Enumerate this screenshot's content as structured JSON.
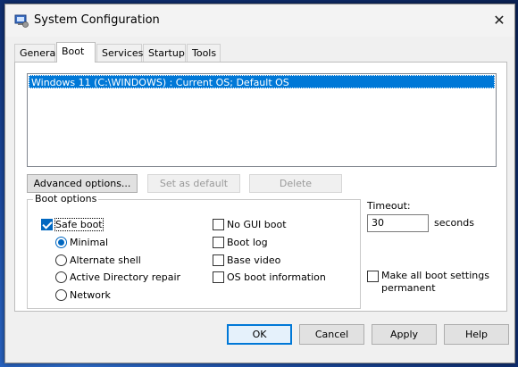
{
  "window": {
    "title": "System Configuration"
  },
  "tabs": [
    {
      "label": "General"
    },
    {
      "label": "Boot"
    },
    {
      "label": "Services"
    },
    {
      "label": "Startup"
    },
    {
      "label": "Tools"
    }
  ],
  "boot_list": {
    "items": [
      {
        "label": "Windows 11 (C:\\WINDOWS) : Current OS; Default OS",
        "selected": true
      }
    ]
  },
  "boot_buttons": {
    "advanced": "Advanced options...",
    "set_default": "Set as default",
    "delete": "Delete"
  },
  "boot_options": {
    "title": "Boot options",
    "safe_boot": {
      "label": "Safe boot",
      "checked": true
    },
    "radios": [
      {
        "label": "Minimal",
        "checked": true
      },
      {
        "label": "Alternate shell",
        "checked": false
      },
      {
        "label": "Active Directory repair",
        "checked": false
      },
      {
        "label": "Network",
        "checked": false
      }
    ],
    "checkboxes": [
      {
        "label": "No GUI boot",
        "checked": false
      },
      {
        "label": "Boot log",
        "checked": false
      },
      {
        "label": "Base video",
        "checked": false
      },
      {
        "label": "OS boot information",
        "checked": false
      }
    ]
  },
  "timeout": {
    "label": "Timeout:",
    "value": "30",
    "unit": "seconds"
  },
  "make_permanent": {
    "line1": "Make all boot settings",
    "line2": "permanent",
    "checked": false
  },
  "footer": {
    "ok": "OK",
    "cancel": "Cancel",
    "apply": "Apply",
    "help": "Help"
  },
  "colors": {
    "selection": "#0078d7",
    "check_accent": "#0067c0"
  }
}
